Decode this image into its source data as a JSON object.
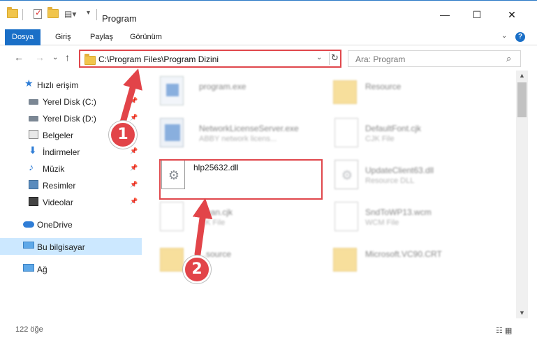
{
  "window": {
    "title": "Program",
    "min_glyph": "—",
    "max_glyph": "☐",
    "close_glyph": "✕"
  },
  "ribbon": {
    "tabs": [
      "Dosya",
      "Giriş",
      "Paylaş",
      "Görünüm"
    ],
    "expand_glyph": "⌄",
    "help_glyph": "?"
  },
  "addressbar": {
    "back_glyph": "←",
    "forward_glyph": "→",
    "recent_glyph": "⌄",
    "up_glyph": "↑",
    "path": "C:\\Program Files\\Program Dizini",
    "dropdown_glyph": "⌄",
    "refresh_glyph": "↻",
    "search_placeholder": "Ara: Program",
    "search_glyph": "⌕"
  },
  "sidebar": {
    "items": [
      {
        "label": "Hızlı erişim",
        "icon": "star-icon"
      },
      {
        "label": "Yerel Disk (C:)",
        "icon": "drive-icon",
        "pinned": true
      },
      {
        "label": "Yerel Disk (D:)",
        "icon": "drive-icon",
        "pinned": true
      },
      {
        "label": "Belgeler",
        "icon": "documents-icon",
        "pinned": true
      },
      {
        "label": "İndirmeler",
        "icon": "downloads-icon",
        "pinned": true
      },
      {
        "label": "Müzik",
        "icon": "music-icon",
        "pinned": true
      },
      {
        "label": "Resimler",
        "icon": "pictures-icon",
        "pinned": true
      },
      {
        "label": "Videolar",
        "icon": "videos-icon",
        "pinned": true
      },
      {
        "label": "OneDrive",
        "icon": "onedrive-icon"
      },
      {
        "label": "Bu bilgisayar",
        "icon": "this-pc-icon",
        "selected": true
      },
      {
        "label": "Ağ",
        "icon": "network-icon"
      }
    ],
    "pin_glyph": "📌"
  },
  "files": [
    {
      "name": "program.exe",
      "type": ""
    },
    {
      "name": "Resource",
      "type": ""
    },
    {
      "name": "NetworkLicenseServer.exe",
      "type": "ABBY network licens..."
    },
    {
      "name": "DefaultFont.cjk",
      "type": "CJK File"
    },
    {
      "name": "hlp25632.dll",
      "type": ""
    },
    {
      "name": "UpdateClient63.dll",
      "type": "Resource DLL"
    },
    {
      "name": "...ean.cjk",
      "type": "...K File"
    },
    {
      "name": "SndToWP13.wcm",
      "type": "WCM File"
    },
    {
      "name": "...source",
      "type": ""
    },
    {
      "name": "Microsoft.VC90.CRT",
      "type": ""
    }
  ],
  "status": {
    "item_count": "122 öğe"
  },
  "annotations": {
    "badge_1": "1",
    "badge_2": "2",
    "color": "#e24449"
  },
  "colors": {
    "accent": "#1a6fc7",
    "selection": "#cce8ff",
    "highlight_box": "#e0474c"
  }
}
